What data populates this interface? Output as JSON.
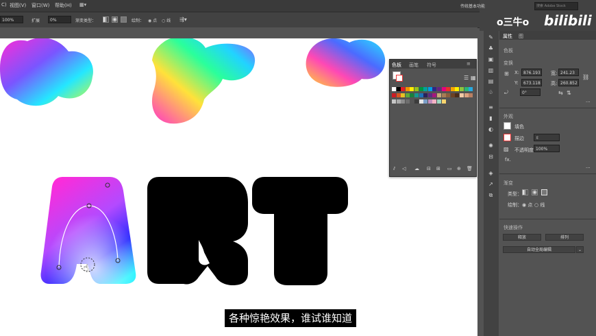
{
  "menu": {
    "items": [
      "C)",
      "视图(V)",
      "窗口(W)",
      "帮助(H)"
    ],
    "workspace": "传统基本功能",
    "search_placeholder": "搜索 Adobe Stock"
  },
  "control": {
    "opacity": "100%",
    "expand_label": "扩展",
    "expand_value": "0%",
    "gradient_type_label": "渐变类型：",
    "draw_label": "绘制：",
    "draw_options": [
      "点",
      "线"
    ]
  },
  "swatch_panel": {
    "tabs": [
      "色板",
      "画笔",
      "符号"
    ]
  },
  "properties": {
    "tabs": [
      "属性",
      "图"
    ],
    "section_color": "色板",
    "section_transform": "变换",
    "x_label": "X:",
    "x_value": "876.193",
    "y_label": "Y:",
    "y_value": "673.118",
    "w_label": "宽:",
    "w_value": "241.23 p",
    "h_label": "高:",
    "h_value": "260.852",
    "rotation": "0°",
    "section_appearance": "外观",
    "fill_label": "填色",
    "stroke_label": "描边",
    "opacity_label": "不透明度",
    "opacity_value": "100%",
    "fx": "fx.",
    "section_gradient": "渐变",
    "type_label": "类型：",
    "draw_label": "绘制：",
    "draw_options": [
      "点",
      "线"
    ],
    "section_quick": "快速操作",
    "release_btn": "释放",
    "arrange_btn": "排列",
    "auto_btn": "自动全局编辑"
  },
  "watermark": {
    "text": "o三牛o",
    "logo": "bilibili"
  },
  "subtitle": "各种惊艳效果，谁试谁知道",
  "artwork": {
    "letters": [
      "A",
      "R",
      "T"
    ]
  }
}
